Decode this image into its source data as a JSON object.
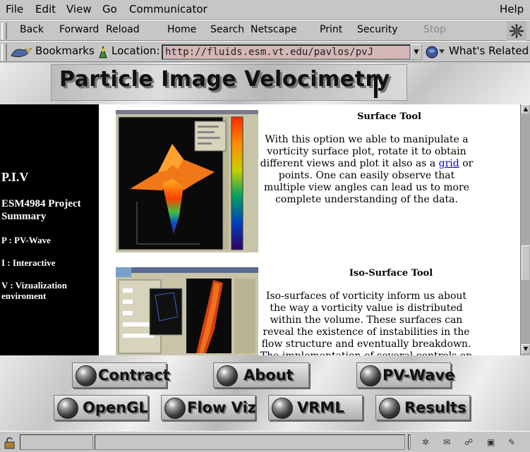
{
  "menu": {
    "file": "File",
    "edit": "Edit",
    "view": "View",
    "go": "Go",
    "communicator": "Communicator",
    "help": "Help"
  },
  "nav": {
    "back": "Back",
    "forward": "Forward",
    "reload": "Reload",
    "home": "Home",
    "search": "Search",
    "netscape": "Netscape",
    "print": "Print",
    "security": "Security",
    "stop": "Stop"
  },
  "location": {
    "bookmarks": "Bookmarks",
    "label": "Location:",
    "url": "http://fluids.esm.vt.edu/pavlos/pvJ",
    "whats_related": "What's Related"
  },
  "header": {
    "title": "Particle Image Velocimetry"
  },
  "sidebar": {
    "piv": "P.I.V",
    "project": "ESM4984 Project Summary",
    "p": "P : PV-Wave",
    "i": "I : Interactive",
    "v": "V : Vizualization enviroment"
  },
  "content": {
    "section1_title": "Surface Tool",
    "section1_text_a": "With this option we able to manipulate a vorticity surface plot, rotate it to obtain different views and plot it also as a ",
    "section1_link": "grid",
    "section1_text_b": " or points. One can easily observe that multiple view angles can lead us to more complete understanding of the data.",
    "section2_title": "Iso-Surface Tool",
    "section2_text": "Iso-surfaces of vorticity inform us about the way a vorticity value is distributed within the volume. These surfaces can reveal the existence of instabilities in the flow structure and eventually breakdown. The implementation of several controls on the"
  },
  "footer": {
    "contract": "Contract",
    "about": "About",
    "pvwave": "PV-Wave",
    "opengl": "OpenGL",
    "flowviz": "Flow Viz",
    "vrml": "VRML",
    "results": "Results"
  },
  "icons": [
    "netscape-logo-icon",
    "bookmarks-icon",
    "location-icon",
    "whats-related-icon",
    "lock-icon",
    "component-icons"
  ]
}
